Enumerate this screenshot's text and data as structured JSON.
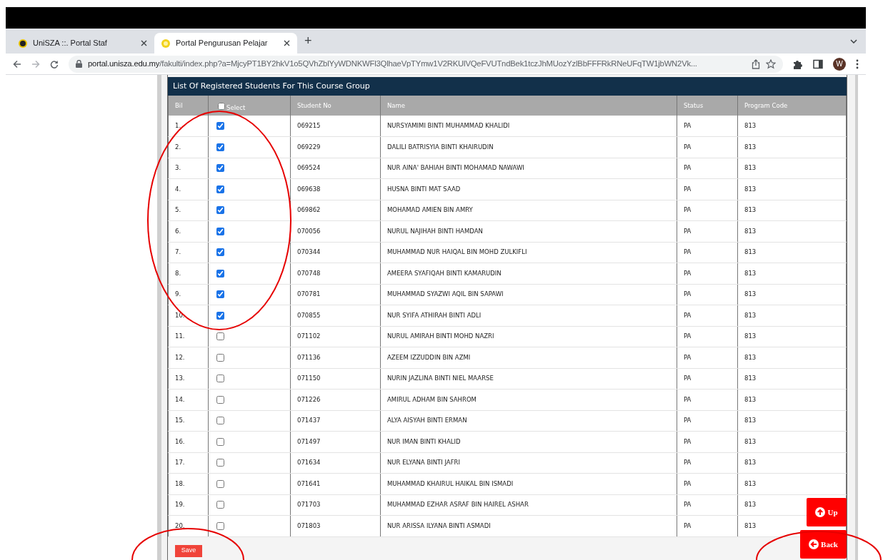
{
  "browser": {
    "tabs": [
      {
        "title": "UniSZA ::. Portal Staf",
        "selected": false
      },
      {
        "title": "Portal Pengurusan Pelajar",
        "selected": true
      }
    ],
    "new_tab": "+",
    "url_host": "portal.unisza.edu.my",
    "url_path": "/fakulti/index.php?a=MjcyPT1BY2hkV1o5QVhZblYyWDNKWFl3QlhaeVpTYmw1V2RKUlVQeFVUTndBek1tczJhMUozYzlBbFFFRkRNeUFqTW1jbWN2Vk...",
    "profile": "W"
  },
  "table": {
    "title": "List Of Registered Students For This Course Group",
    "columns": [
      "Bil",
      "Select",
      "Student No",
      "Name",
      "Status",
      "Program Code"
    ],
    "select_all": {
      "checked": false
    },
    "rows": [
      {
        "bil": "1.",
        "checked": true,
        "student_no": "069215",
        "name": "NURSYAMIMI BINTI MUHAMMAD KHALIDI",
        "status": "PA",
        "program_code": "813"
      },
      {
        "bil": "2.",
        "checked": true,
        "student_no": "069229",
        "name": "DALILI BATRISYIA BINTI KHAIRUDIN",
        "status": "PA",
        "program_code": "813"
      },
      {
        "bil": "3.",
        "checked": true,
        "student_no": "069524",
        "name": "NUR AINA' BAHIAH BINTI MOHAMAD NAWAWI",
        "status": "PA",
        "program_code": "813"
      },
      {
        "bil": "4.",
        "checked": true,
        "student_no": "069638",
        "name": "HUSNA BINTI MAT SAAD",
        "status": "PA",
        "program_code": "813"
      },
      {
        "bil": "5.",
        "checked": true,
        "student_no": "069862",
        "name": "MOHAMAD AMIEN BIN AMRY",
        "status": "PA",
        "program_code": "813"
      },
      {
        "bil": "6.",
        "checked": true,
        "student_no": "070056",
        "name": "NURUL NAJIHAH BINTI HAMDAN",
        "status": "PA",
        "program_code": "813"
      },
      {
        "bil": "7.",
        "checked": true,
        "student_no": "070344",
        "name": "MUHAMMAD NUR HAIQAL BIN MOHD ZULKIFLI",
        "status": "PA",
        "program_code": "813"
      },
      {
        "bil": "8.",
        "checked": true,
        "student_no": "070748",
        "name": "AMEERA SYAFIQAH BINTI KAMARUDIN",
        "status": "PA",
        "program_code": "813"
      },
      {
        "bil": "9.",
        "checked": true,
        "student_no": "070781",
        "name": "MUHAMMAD SYAZWI AQIL BIN SAPAWI",
        "status": "PA",
        "program_code": "813"
      },
      {
        "bil": "10.",
        "checked": true,
        "student_no": "070855",
        "name": "NUR SYIFA ATHIRAH BINTI ADLI",
        "status": "PA",
        "program_code": "813"
      },
      {
        "bil": "11.",
        "checked": false,
        "student_no": "071102",
        "name": "NURUL AMIRAH BINTI MOHD NAZRI",
        "status": "PA",
        "program_code": "813"
      },
      {
        "bil": "12.",
        "checked": false,
        "student_no": "071136",
        "name": "AZEEM IZZUDDIN BIN AZMI",
        "status": "PA",
        "program_code": "813"
      },
      {
        "bil": "13.",
        "checked": false,
        "student_no": "071150",
        "name": "NURIN JAZLINA BINTI NIEL MAARSE",
        "status": "PA",
        "program_code": "813"
      },
      {
        "bil": "14.",
        "checked": false,
        "student_no": "071226",
        "name": "AMIRUL ADHAM BIN SAHROM",
        "status": "PA",
        "program_code": "813"
      },
      {
        "bil": "15.",
        "checked": false,
        "student_no": "071437",
        "name": "ALYA AISYAH BINTI ERMAN",
        "status": "PA",
        "program_code": "813"
      },
      {
        "bil": "16.",
        "checked": false,
        "student_no": "071497",
        "name": "NUR IMAN BINTI KHALID",
        "status": "PA",
        "program_code": "813"
      },
      {
        "bil": "17.",
        "checked": false,
        "student_no": "071634",
        "name": "NUR ELYANA BINTI JAFRI",
        "status": "PA",
        "program_code": "813"
      },
      {
        "bil": "18.",
        "checked": false,
        "student_no": "071641",
        "name": "MUHAMMAD KHAIRUL HAIKAL BIN ISMADI",
        "status": "PA",
        "program_code": "813"
      },
      {
        "bil": "19.",
        "checked": false,
        "student_no": "071703",
        "name": "MUHAMMAD EZHAR ASRAF BIN HAIREL ASHAR",
        "status": "PA",
        "program_code": "813"
      },
      {
        "bil": "20.",
        "checked": false,
        "student_no": "071803",
        "name": "NUR ARISSA ILYANA BINTI ASMADI",
        "status": "PA",
        "program_code": "813"
      }
    ],
    "save_button": "Save"
  },
  "up_button": "Up",
  "back_button": "Back"
}
